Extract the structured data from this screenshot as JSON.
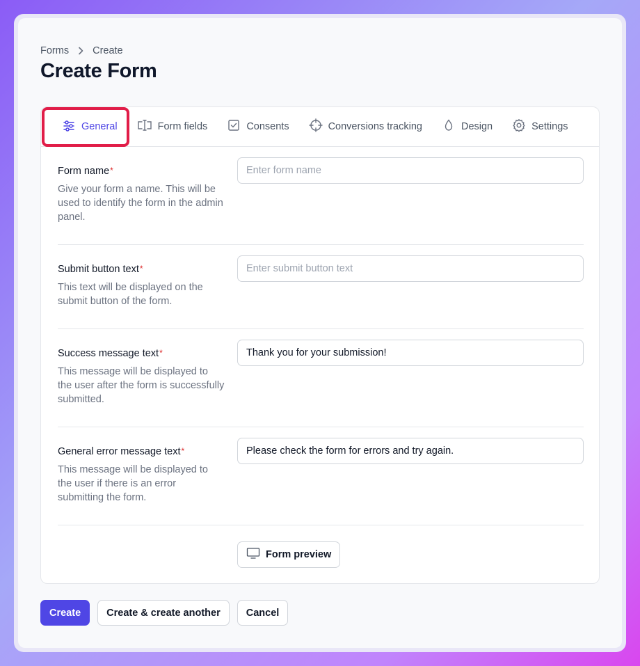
{
  "breadcrumb": {
    "items": [
      "Forms",
      "Create"
    ]
  },
  "page": {
    "title": "Create Form"
  },
  "tabs": [
    {
      "label": "General",
      "icon": "sliders-icon",
      "active": true
    },
    {
      "label": "Form fields",
      "icon": "text-cursor-input-icon",
      "active": false
    },
    {
      "label": "Consents",
      "icon": "checkbox-icon",
      "active": false
    },
    {
      "label": "Conversions tracking",
      "icon": "crosshair-icon",
      "active": false
    },
    {
      "label": "Design",
      "icon": "droplet-icon",
      "active": false
    },
    {
      "label": "Settings",
      "icon": "gear-icon",
      "active": false
    }
  ],
  "fields": {
    "form_name": {
      "label": "Form name",
      "required_mark": "*",
      "description": "Give your form a name. This will be used to identify the form in the admin panel.",
      "placeholder": "Enter form name",
      "value": ""
    },
    "submit_text": {
      "label": "Submit button text",
      "required_mark": "*",
      "description": "This text will be displayed on the submit button of the form.",
      "placeholder": "Enter submit button text",
      "value": ""
    },
    "success_message": {
      "label": "Success message text",
      "required_mark": "*",
      "description": "This message will be displayed to the user after the form is successfully submitted.",
      "placeholder": "",
      "value": "Thank you for your submission!"
    },
    "error_message": {
      "label": "General error message text",
      "required_mark": "*",
      "description": "This message will be displayed to the user if there is an error submitting the form.",
      "placeholder": "",
      "value": "Please check the form for errors and try again."
    }
  },
  "preview": {
    "label": "Form preview",
    "icon": "monitor-icon"
  },
  "actions": {
    "create": "Create",
    "create_another": "Create & create another",
    "cancel": "Cancel"
  },
  "colors": {
    "accent": "#4f46e5",
    "highlight": "#e11d48",
    "required": "#dc2626"
  }
}
